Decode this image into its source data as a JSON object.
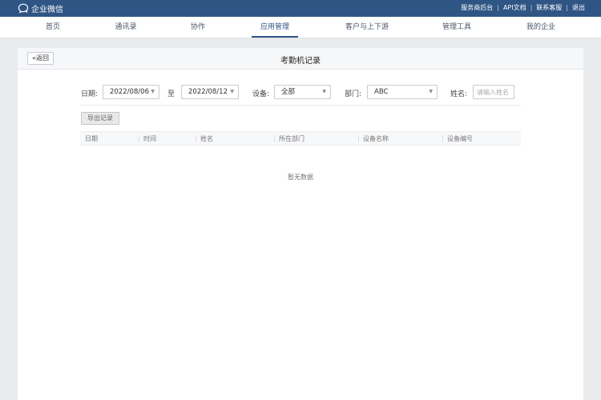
{
  "topbar": {
    "brand": "企业微信",
    "links": [
      "服务商后台",
      "API文档",
      "联系客服",
      "退出"
    ]
  },
  "nav": {
    "items": [
      "首页",
      "通讯录",
      "协作",
      "应用管理",
      "客户与上下游",
      "管理工具",
      "我的企业"
    ],
    "active": "应用管理"
  },
  "page": {
    "back_label": "返回",
    "title": "考勤机记录"
  },
  "filters": {
    "date_label": "日期:",
    "date_from": "2022/08/06",
    "to_label": "至",
    "date_to": "2022/08/12",
    "device_label": "设备:",
    "device_value": "全部",
    "dept_label": "部门:",
    "dept_value": "ABC",
    "name_label": "姓名:",
    "name_placeholder": "请输入姓名",
    "name_value": ""
  },
  "actions": {
    "export_label": "导出记录"
  },
  "table": {
    "columns": [
      "日期",
      "时间",
      "姓名",
      "所在部门",
      "设备名称",
      "设备编号"
    ],
    "empty_text": "暂无数据"
  },
  "colors": {
    "brand": "#2f5584",
    "page_bg": "#e9eaec"
  }
}
